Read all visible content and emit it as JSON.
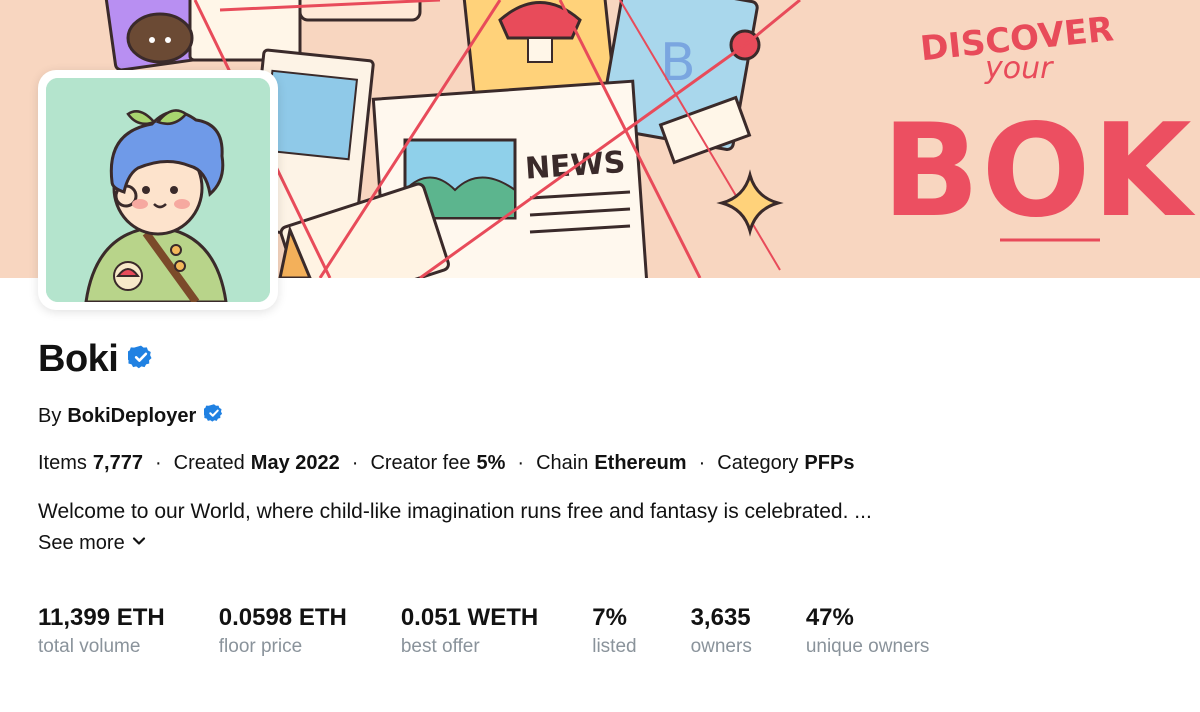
{
  "banner": {
    "slogan_line1": "DISCOVER",
    "slogan_line2": "your",
    "brand": "BOKI",
    "news_label": "NEWS",
    "sticker_letter": "B"
  },
  "collection": {
    "title": "Boki",
    "by_label": "By",
    "creator": "BokiDeployer"
  },
  "meta": [
    {
      "label": "Items",
      "value": "7,777"
    },
    {
      "label": "Created",
      "value": "May 2022"
    },
    {
      "label": "Creator fee",
      "value": "5%"
    },
    {
      "label": "Chain",
      "value": "Ethereum"
    },
    {
      "label": "Category",
      "value": "PFPs"
    }
  ],
  "meta_separator": "·",
  "description": "Welcome to our World, where child-like imagination runs free and fantasy is celebrated. ...",
  "see_more_label": "See more",
  "stats": [
    {
      "value": "11,399 ETH",
      "label": "total volume"
    },
    {
      "value": "0.0598 ETH",
      "label": "floor price"
    },
    {
      "value": "0.051 WETH",
      "label": "best offer"
    },
    {
      "value": "7%",
      "label": "listed"
    },
    {
      "value": "3,635",
      "label": "owners"
    },
    {
      "value": "47%",
      "label": "unique owners"
    }
  ],
  "colors": {
    "banner_bg": "#f8d6c0",
    "brand_red": "#ec4f61",
    "verified_blue": "#2081e2",
    "avatar_bg": "#b4e4cd",
    "label_gray": "#8a939b"
  }
}
